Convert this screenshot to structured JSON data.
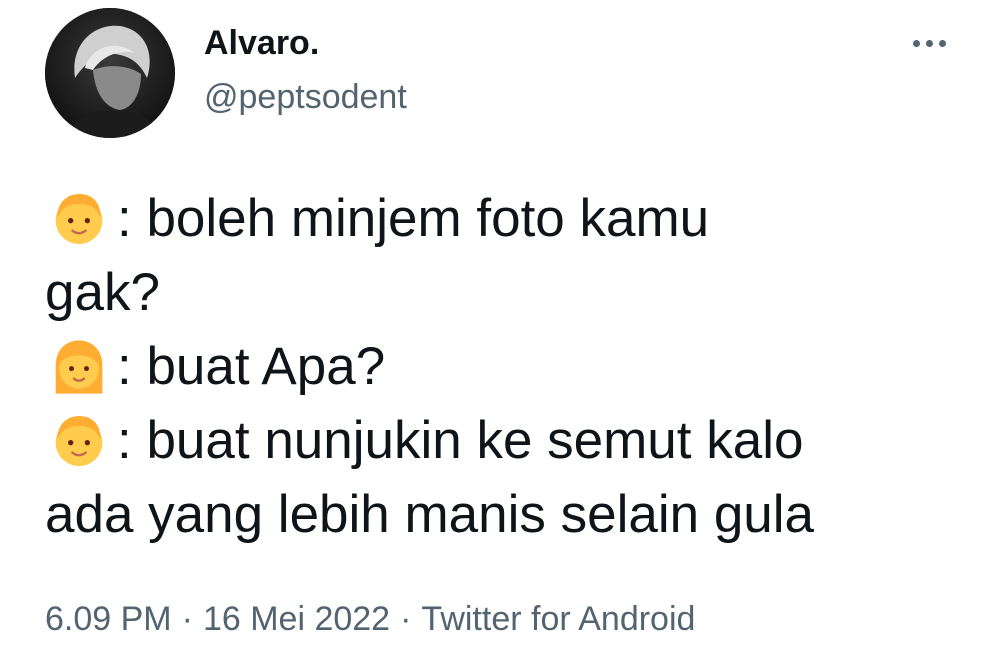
{
  "user": {
    "display_name": "Alvaro.",
    "handle": "@peptsodent",
    "avatar_icon": "profile-photo"
  },
  "more_button": {
    "icon": "more-horizontal-icon"
  },
  "tweet_lines": [
    {
      "emoji": "boy-face-emoji",
      "text": ": boleh minjem foto kamu"
    },
    {
      "emoji": "",
      "text": "gak?"
    },
    {
      "emoji": "girl-face-emoji",
      "text": ": buat Apa?"
    },
    {
      "emoji": "boy-face-emoji",
      "text": ": buat nunjukin ke semut kalo"
    },
    {
      "emoji": "",
      "text": "ada yang lebih manis selain gula"
    }
  ],
  "meta": {
    "time": "6.09 PM",
    "separator": "·",
    "date": "16 Mei 2022",
    "source": "Twitter for Android"
  },
  "colors": {
    "text_primary": "#0f1419",
    "text_secondary": "#536471",
    "emoji_skin": "#FFCC4D",
    "emoji_hair": "#FFAC33"
  }
}
